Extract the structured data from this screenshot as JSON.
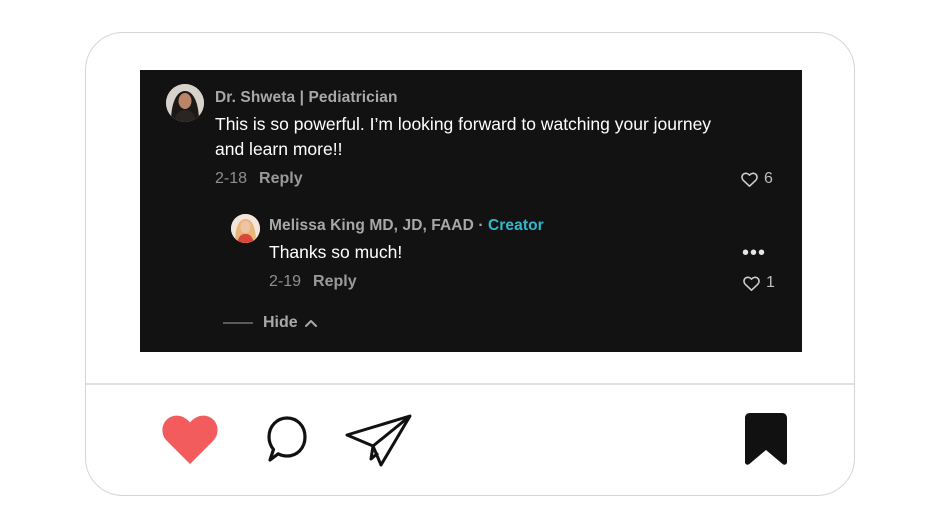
{
  "colors": {
    "card_bg": "#ffffff",
    "screenshot_bg": "#121212",
    "creator_accent": "#2fb9cf",
    "like_red": "#f25c5c",
    "icon_black": "#111111"
  },
  "comments": [
    {
      "author": "Dr. Shweta | Pediatrician",
      "text": "This is so powerful. I’m looking forward to watching your journey and learn more!!",
      "date": "2-18",
      "reply_label": "Reply",
      "likes": "6"
    }
  ],
  "reply": {
    "author": "Melissa King MD, JD, FAAD",
    "separator": " · ",
    "badge": "Creator",
    "text": "Thanks so much!",
    "date": "2-19",
    "reply_label": "Reply",
    "likes": "1",
    "more": "•••"
  },
  "hide_label": "Hide",
  "actions": {
    "like_icon": "heart-filled-icon",
    "comment_icon": "speech-bubble-icon",
    "share_icon": "paper-plane-icon",
    "save_icon": "bookmark-icon"
  }
}
